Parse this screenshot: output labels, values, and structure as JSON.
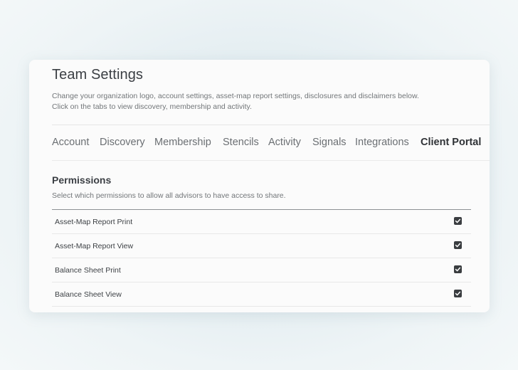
{
  "header": {
    "title": "Team Settings",
    "description_line1": "Change your organization logo, account settings, asset-map report settings, disclosures and disclaimers below.",
    "description_line2": "Click on the tabs to view discovery, membership and activity."
  },
  "tabs": [
    {
      "label": "Account",
      "active": false
    },
    {
      "label": "Discovery",
      "active": false
    },
    {
      "label": "Membership",
      "active": false
    },
    {
      "label": "Stencils",
      "active": false
    },
    {
      "label": "Activity",
      "active": false
    },
    {
      "label": "Signals",
      "active": false
    },
    {
      "label": "Integrations",
      "active": false
    },
    {
      "label": "Client Portal",
      "active": true
    }
  ],
  "permissions": {
    "title": "Permissions",
    "description": "Select which permissions to allow all advisors to have access to share.",
    "items": [
      {
        "label": "Asset-Map Report Print",
        "checked": true
      },
      {
        "label": "Asset-Map Report View",
        "checked": true
      },
      {
        "label": "Balance Sheet Print",
        "checked": true
      },
      {
        "label": "Balance Sheet View",
        "checked": true
      }
    ]
  },
  "colors": {
    "checkbox_fill": "#3a3d40",
    "active_tab": "#2f3236",
    "inactive_tab": "#6b6f73"
  }
}
